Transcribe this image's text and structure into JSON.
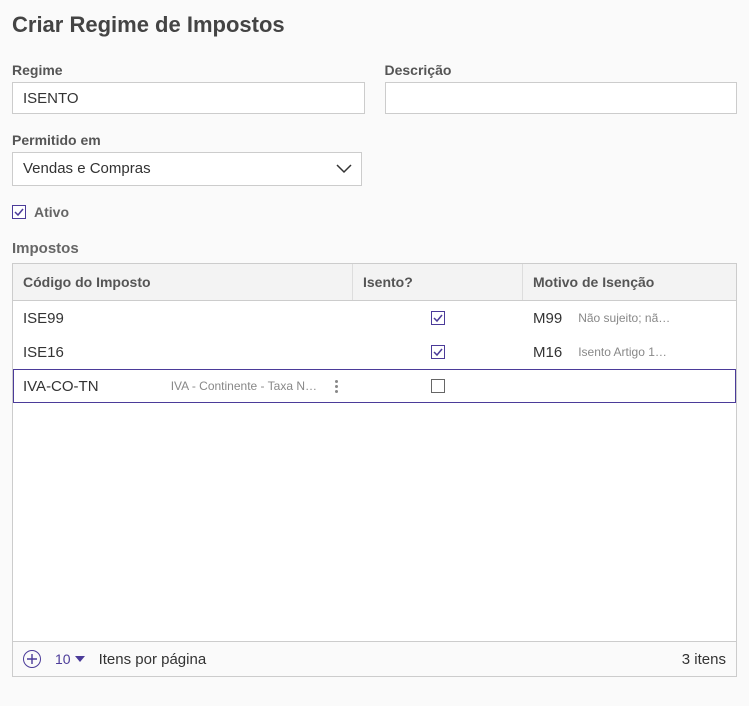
{
  "page_title": "Criar Regime de Impostos",
  "fields": {
    "regime": {
      "label": "Regime",
      "value": "ISENTO"
    },
    "descricao": {
      "label": "Descrição",
      "value": ""
    },
    "permitido_em": {
      "label": "Permitido em",
      "value": "Vendas e Compras"
    },
    "ativo": {
      "label": "Ativo",
      "checked": true
    }
  },
  "grid": {
    "title": "Impostos",
    "headers": {
      "codigo": "Código do Imposto",
      "isento": "Isento?",
      "motivo": "Motivo de Isenção"
    },
    "rows": [
      {
        "codigo": "ISE99",
        "codigo_desc": "",
        "isento": true,
        "motivo_code": "M99",
        "motivo_desc": "Não sujeito; nã…",
        "selected": false
      },
      {
        "codigo": "ISE16",
        "codigo_desc": "",
        "isento": true,
        "motivo_code": "M16",
        "motivo_desc": "Isento Artigo 1…",
        "selected": false
      },
      {
        "codigo": "IVA-CO-TN",
        "codigo_desc": "IVA - Continente - Taxa N…",
        "isento": false,
        "motivo_code": "",
        "motivo_desc": "",
        "selected": true
      }
    ],
    "footer": {
      "page_size": "10",
      "page_size_label": "Itens por página",
      "total_text": "3 itens"
    }
  }
}
